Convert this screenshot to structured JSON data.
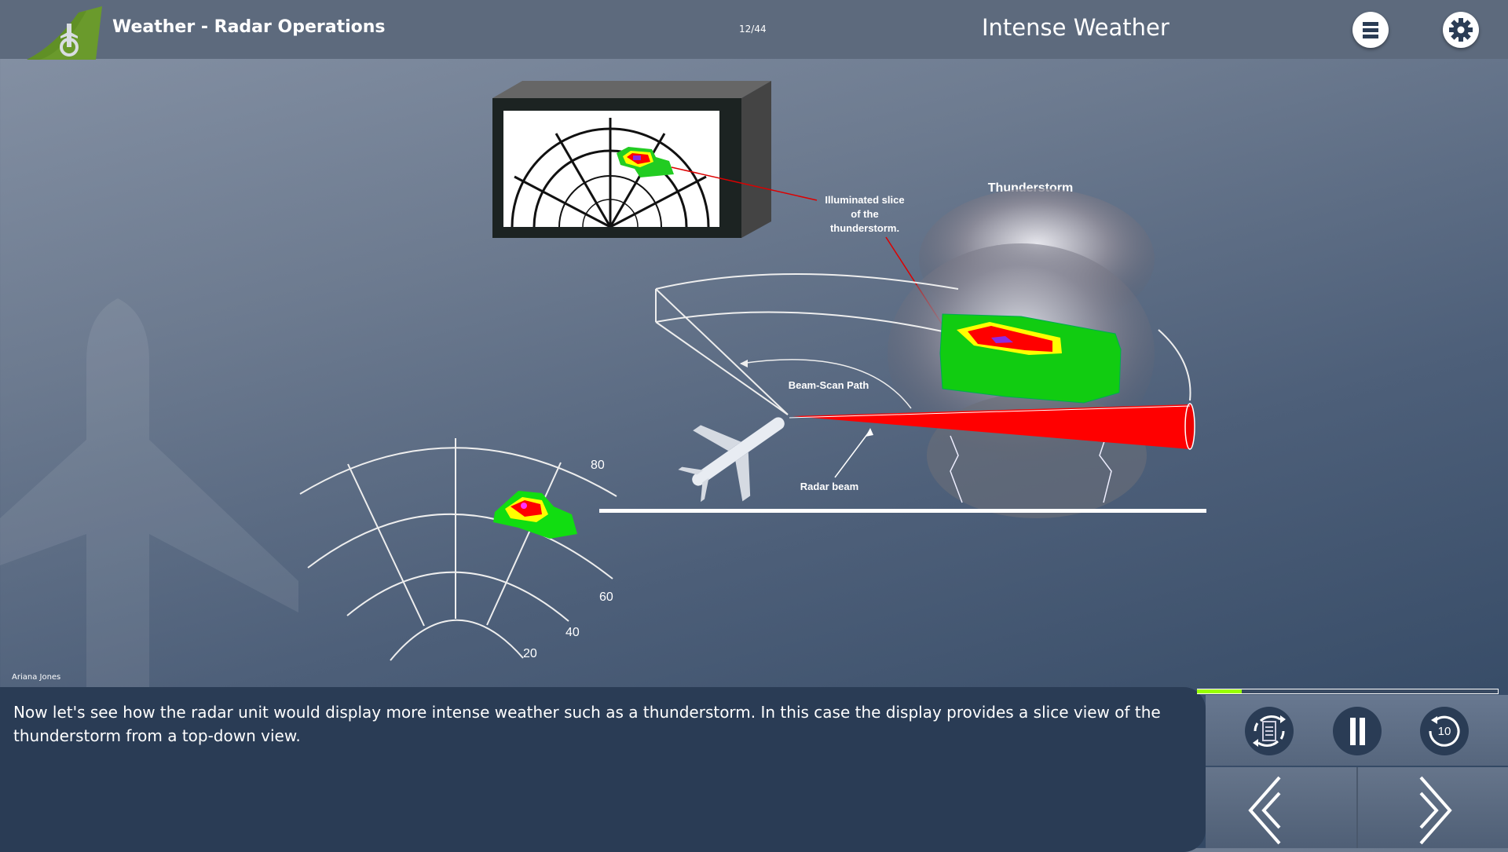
{
  "header": {
    "app_title": "Weather - Radar Operations",
    "page_counter": "12/44",
    "slide_title": "Intense Weather",
    "menu_icon": "hamburger-menu-icon",
    "settings_icon": "gear-icon",
    "brand_color": "#6a9a2c"
  },
  "diagram": {
    "label_thunderstorm": "Thunderstorm",
    "label_slice_1": "Illuminated slice",
    "label_slice_2": "of the",
    "label_slice_3": "thunderstorm.",
    "label_beam_scan": "Beam-Scan Path",
    "label_radar_beam": "Radar beam",
    "range_labels": [
      "80",
      "60",
      "40",
      "20"
    ]
  },
  "presenter": "Ariana Jones",
  "caption": "Now let's see how the radar unit would display more intense weather such as a thunderstorm. In this case the display provides a slice view of the thunderstorm from a top-down view.",
  "progress": {
    "percent": 15,
    "fill_color": "#99ff00"
  },
  "controls": {
    "transcript_icon": "transcript-replay-icon",
    "pause_icon": "pause-icon",
    "rewind_icon": "rewind-10-icon",
    "rewind_seconds": "10",
    "prev_icon": "chevron-left-icon",
    "next_icon": "chevron-right-icon"
  }
}
